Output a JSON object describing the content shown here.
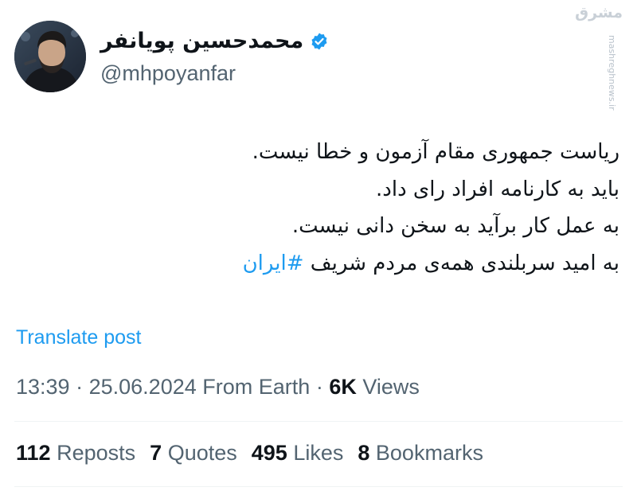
{
  "author": {
    "display_name": "محمدحسین پویانفر",
    "handle": "@mhpoyanfar",
    "verified": true
  },
  "watermark": {
    "logo": "مشرق",
    "url": "mashreghnews.ir"
  },
  "tweet": {
    "lines": [
      "ریاست جمهوری مقام آزمون و خطا نیست.",
      "باید به کارنامه افراد رای داد.",
      "به عمل کار برآید به سخن دانی نیست."
    ],
    "last_line_text": "به امید سربلندی همه‌ی مردم شریف ",
    "hashtag": "#ایران"
  },
  "translate_label": "Translate post",
  "meta": {
    "time": "13:39",
    "separator": "·",
    "date": "25.06.2024",
    "source": "From Earth",
    "views_count": "6K",
    "views_label": "Views"
  },
  "stats": {
    "reposts_count": "112",
    "reposts_label": "Reposts",
    "quotes_count": "7",
    "quotes_label": "Quotes",
    "likes_count": "495",
    "likes_label": "Likes",
    "bookmarks_count": "8",
    "bookmarks_label": "Bookmarks"
  },
  "colors": {
    "accent": "#1d9bf0",
    "secondary_text": "#536471",
    "primary_text": "#0f1419",
    "divider": "#eff3f4"
  }
}
